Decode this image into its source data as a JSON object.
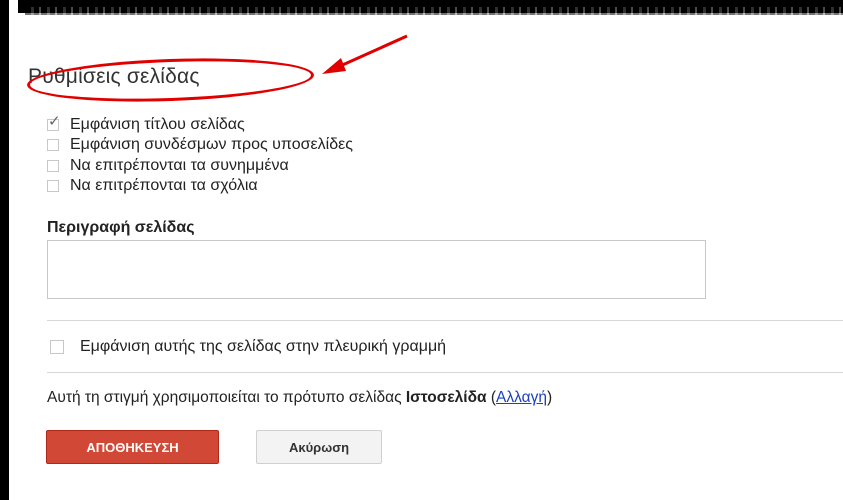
{
  "settings": {
    "title": "Ρυθμίσεις σελίδας",
    "options": [
      {
        "label": "Εμφάνιση τίτλου σελίδας",
        "checked": true
      },
      {
        "label": "Εμφάνιση συνδέσμων προς υποσελίδες",
        "checked": false
      },
      {
        "label": "Να επιτρέπονται τα συνημμένα",
        "checked": false
      },
      {
        "label": "Να επιτρέπονται τα σχόλια",
        "checked": false
      }
    ],
    "description_label": "Περιγραφή σελίδας",
    "description_value": "",
    "sidebar_option": {
      "label": "Εμφάνιση αυτής της σελίδας στην πλευρική γραμμή",
      "checked": false
    },
    "template_prefix": "Αυτή τη στιγμή χρησιμοποιείται το πρότυπο σελίδας ",
    "template_name": "Ιστοσελίδα",
    "template_open": " (",
    "change_link": "Αλλαγή",
    "template_close": ")",
    "save_label": "ΑΠΟΘΗΚΕΥΣΗ",
    "cancel_label": "Ακύρωση"
  },
  "colors": {
    "save_button": "#d14836",
    "annotation_red": "#e00000",
    "link": "#1a3fc4"
  },
  "icons": {
    "checked": "check-icon"
  }
}
